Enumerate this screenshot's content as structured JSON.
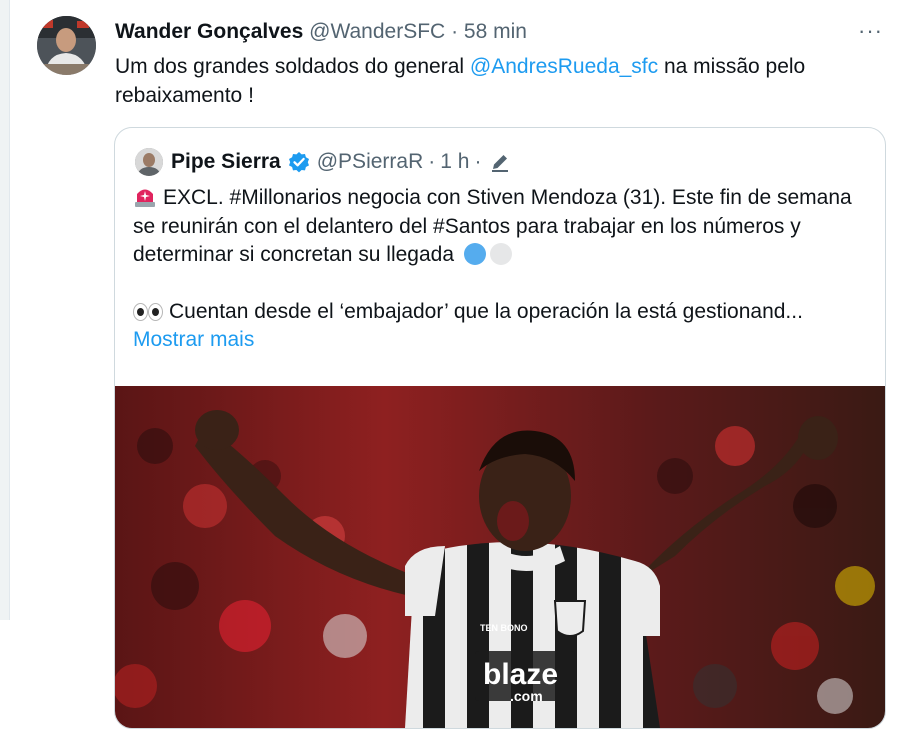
{
  "tweet": {
    "author_name": "Wander Gonçalves",
    "handle": "@WanderSFC",
    "separator": "·",
    "time": "58 min",
    "more_label": "···",
    "text_before": "Um dos grandes soldados do general ",
    "mention": "@AndresRueda_sfc",
    "text_after": " na missão pelo rebaixamento !"
  },
  "quote": {
    "author_name": "Pipe Sierra",
    "handle": "@PSierraR",
    "separator": "·",
    "time": "1 h",
    "separator2": "·",
    "line1": "EXCL. #Millonarios negocia con Stiven Mendoza (31). Este fin de semana se reunirán con el delantero del #Santos para trabajar en los números y determinar si concretan su llegada",
    "line2": "Cuentan desde el ‘embajador’ que la operación la está gestionand...",
    "show_more": "Mostrar mais",
    "photo_text": {
      "sponsor": "blaze",
      "sponsor_suffix": ".com",
      "kit_brand": "TEN BONO"
    }
  },
  "colors": {
    "accent": "#1d9bf0",
    "muted": "#536471",
    "border": "#cfd9de"
  },
  "icons": [
    "more-icon",
    "verified-badge-icon",
    "pencil-icon",
    "siren-emoji",
    "blue-circle-emoji",
    "white-circle-emoji",
    "eyes-emoji"
  ]
}
